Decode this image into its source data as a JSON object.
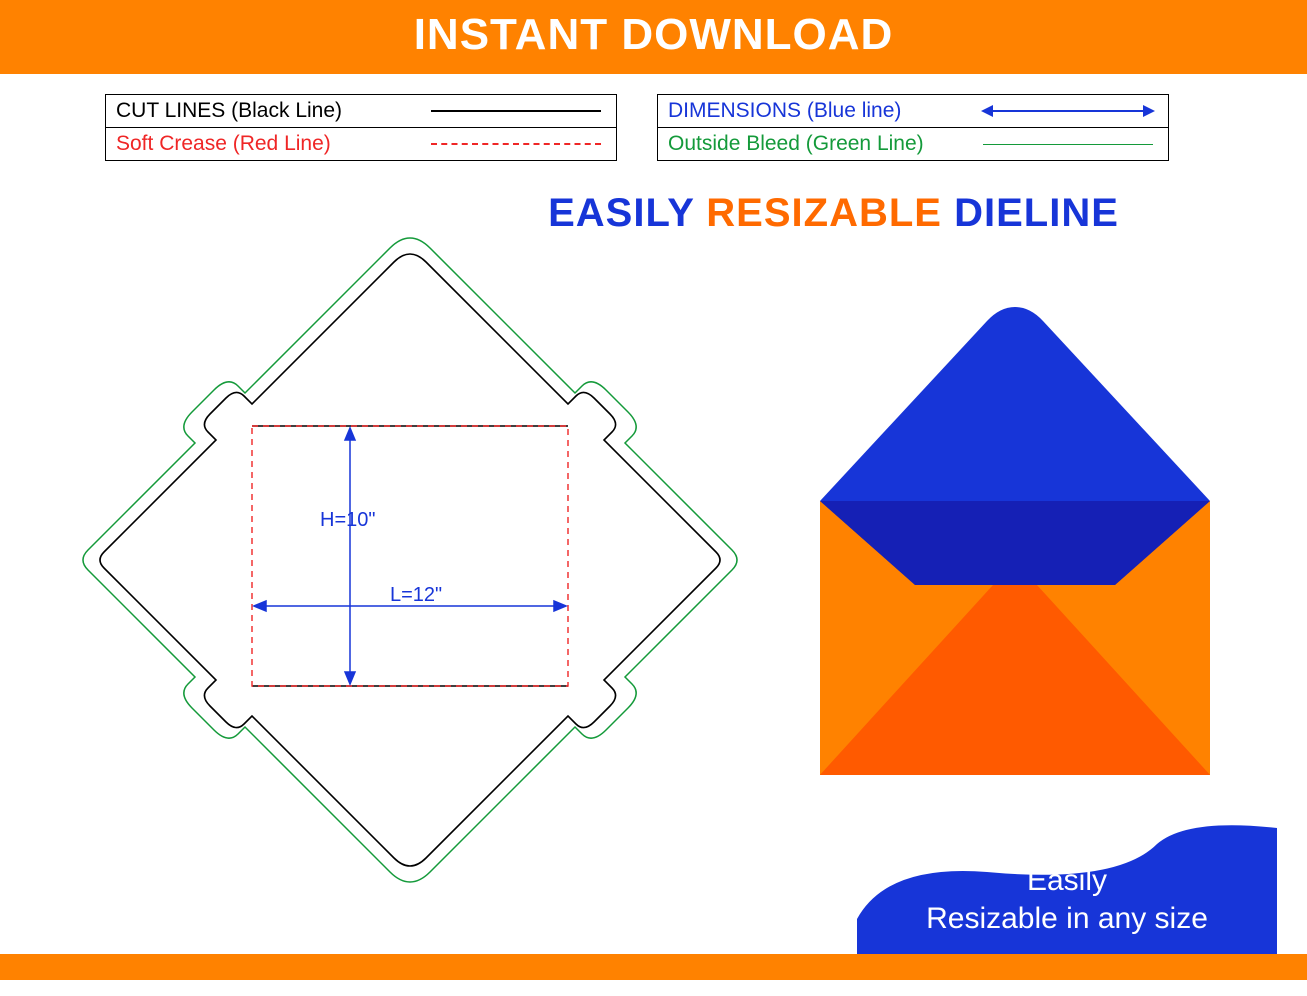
{
  "header": {
    "title": "INSTANT DOWNLOAD"
  },
  "legend": {
    "left": [
      {
        "label": "CUT LINES (Black Line)",
        "color": "#000000",
        "style": "solid"
      },
      {
        "label": "Soft Crease (Red Line)",
        "color": "#ef2626",
        "style": "dashed"
      }
    ],
    "right": [
      {
        "label": "DIMENSIONS (Blue line)",
        "color": "#1735d8",
        "style": "arrow"
      },
      {
        "label": "Outside Bleed (Green Line)",
        "color": "#149a3a",
        "style": "solid"
      }
    ]
  },
  "tagline": {
    "w1": "EASILY",
    "w2": "RESIZABLE",
    "w3": "DIELINE"
  },
  "dimensions": {
    "height_label": "H=10\"",
    "length_label": "L=12\"",
    "height_value": 10,
    "length_value": 12,
    "unit": "inch"
  },
  "colors": {
    "orange": "#ff8200",
    "orange_dark": "#ff5a00",
    "blue": "#1735d8",
    "blue_dark": "#1520b5",
    "green": "#149a3a",
    "red": "#ef2626",
    "black": "#000000"
  },
  "footer": {
    "line1": "Easily",
    "line2": "Resizable in any size"
  }
}
